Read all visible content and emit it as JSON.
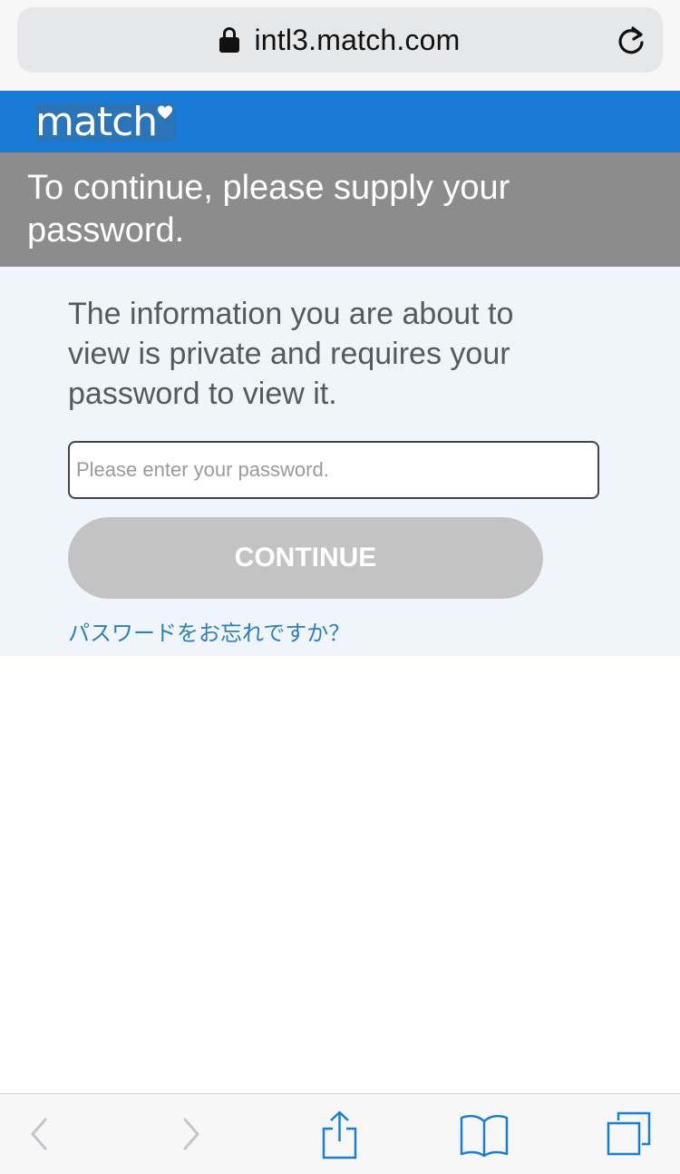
{
  "browser": {
    "url": "intl3.match.com",
    "icons": {
      "lock": "lock-icon",
      "reload": "reload-icon"
    }
  },
  "brand": {
    "logo": "match"
  },
  "header": {
    "title": "To continue, please supply your password."
  },
  "main": {
    "info": "The information you are about to view is private and requires your password to view it.",
    "password_placeholder": "Please enter your password.",
    "password_value": "",
    "continue_label": "CONTINUE",
    "forgot_link": "パスワードをお忘れですか？"
  },
  "toolbar": {
    "icons": [
      "back-icon",
      "forward-icon",
      "share-icon",
      "bookmarks-icon",
      "tabs-icon"
    ]
  },
  "colors": {
    "brand_blue": "#1a7bd6",
    "header_gray": "#8c8c8c",
    "content_bg": "#f0f5fb",
    "button_disabled": "#c3c3c3",
    "link_blue": "#2f7fb6",
    "toolbar_blue": "#1b7fd1"
  }
}
